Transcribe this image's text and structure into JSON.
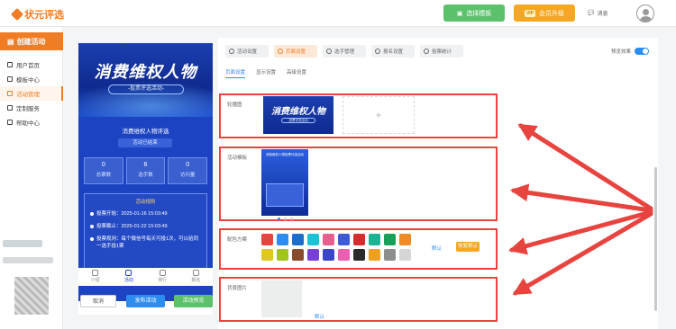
{
  "app": {
    "logo_text": "状元评选"
  },
  "header": {
    "template_btn": "选择模板",
    "vip_btn": "会员升级",
    "vip_badge": "VIP",
    "message": "消息"
  },
  "sidebar": {
    "create": "创建活动",
    "items": [
      {
        "label": "用户首页",
        "active": false
      },
      {
        "label": "模板中心",
        "active": false
      },
      {
        "label": "活动管理",
        "active": true
      },
      {
        "label": "定制服务",
        "active": false
      },
      {
        "label": "帮助中心",
        "active": false
      }
    ]
  },
  "phone": {
    "banner_title": "消费维权人物",
    "banner_sub": "-投票评选活动-",
    "title": "消费维权人物评选",
    "status": "活动已结束",
    "stats": [
      {
        "num": "0",
        "label": "总票数"
      },
      {
        "num": "6",
        "label": "选手数"
      },
      {
        "num": "0",
        "label": "访问量"
      }
    ],
    "rules_head": "活动规则",
    "rules": [
      "投票开始：2025-01-16 15:03:49",
      "投票截止：2025-01-22 15:03:49",
      "投票规则：每个微信号每天可投1次，可以给同一选手投1票"
    ],
    "tabs": [
      "介绍",
      "活动",
      "排行",
      "报名"
    ]
  },
  "actions": {
    "cancel": "取消",
    "publish": "发布活动",
    "preview": "活动预览"
  },
  "panel": {
    "steps": [
      "活动设置",
      "页面设置",
      "选手管理",
      "报名设置",
      "投票统计"
    ],
    "active_step": 1,
    "preview_label": "预览效果",
    "sub_tabs": [
      "页面设置",
      "显示设置",
      "高级设置"
    ],
    "cover": {
      "label": "轮播图",
      "thumb_title": "消费维权人物",
      "thumb_sub": "-投票评选活动-",
      "plus": "+"
    },
    "template": {
      "label": "活动模板",
      "thumb_text": "消费维权人物投票评选活动"
    },
    "colors": {
      "label": "配色方案",
      "swatches": [
        "#e8443f",
        "#2d8cf0",
        "#1a6fc9",
        "#1cc3d6",
        "#e85d8f",
        "#3d5bd9",
        "#d42d2d",
        "#1ab394",
        "#18a05a",
        "#f08a24",
        "#e0c81e",
        "#a1c41e",
        "#8b4a2b",
        "#7a3fd6",
        "#3a46c7",
        "#ec5fb0",
        "#2a2a2a",
        "#f0a020",
        "#8e8e8e",
        "#d6d6d6"
      ],
      "default": "默认",
      "reset": "恢复默认"
    },
    "background": {
      "label": "背景图片",
      "default": "默认"
    }
  }
}
